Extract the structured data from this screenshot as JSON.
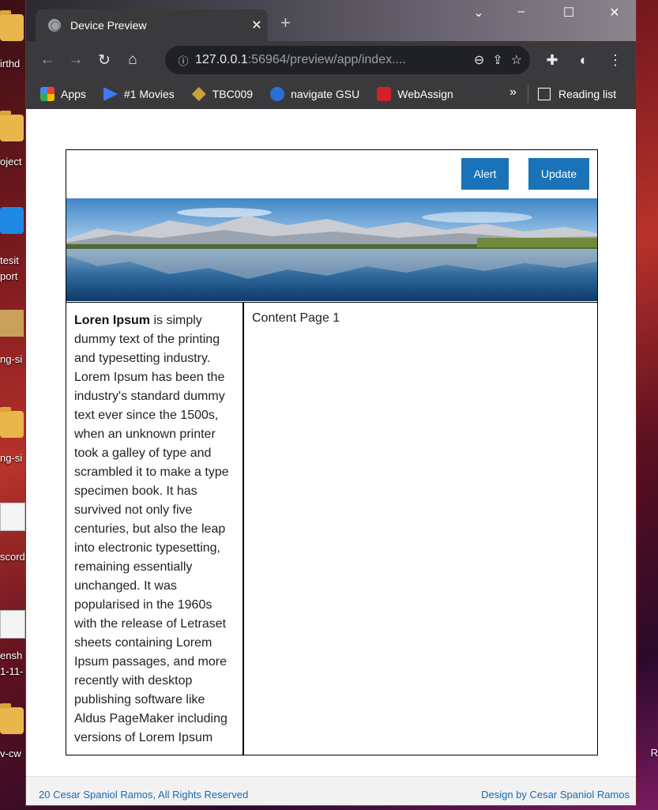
{
  "desktop": {
    "icons": [
      {
        "label": "irthd",
        "kind": "folder"
      },
      {
        "label": "oject",
        "kind": "folder"
      },
      {
        "label": "tesit",
        "label2": "port",
        "kind": "app"
      },
      {
        "label": "ng-si",
        "kind": "package"
      },
      {
        "label": "ng-si",
        "kind": "folder"
      },
      {
        "label": "scord",
        "kind": "doc"
      },
      {
        "label": "ensh",
        "label2": "1-11-",
        "kind": "image"
      },
      {
        "label": "v-cw",
        "kind": "folder"
      }
    ],
    "right_fragment": "R"
  },
  "browser": {
    "tab_title": "Device Preview",
    "url_host": "127.0.0.1",
    "url_rest": ":56964/preview/app/index....",
    "bookmarks": [
      {
        "label": "Apps",
        "icon": "apps-grid-icon",
        "color": "#4285f4"
      },
      {
        "label": "#1 Movies",
        "icon": "play-arrow-icon",
        "color": "#3d7bff"
      },
      {
        "label": "TBC009",
        "icon": "diamond-icon",
        "color": "#c9a23a"
      },
      {
        "label": "navigate GSU",
        "icon": "university-icon",
        "color": "#2a6fd6"
      },
      {
        "label": "WebAssign",
        "icon": "webassign-icon",
        "color": "#d0202a"
      }
    ],
    "more_bookmarks": "»",
    "reading_list": "Reading list"
  },
  "page": {
    "buttons": {
      "alert": "Alert",
      "update": "Update"
    },
    "left_bold": "Loren Ipsum",
    "left_text": " is simply dummy text of the printing and typesetting industry. Lorem Ipsum has been the industry's standard dummy text ever since the 1500s, when an unknown printer took a galley of type and scrambled it to make a type specimen book. It has survived not only five centuries, but also the leap into electronic typesetting, remaining essentially unchanged. It was popularised in the 1960s with the release of Letraset sheets containing Lorem Ipsum passages, and more recently with desktop publishing software like Aldus PageMaker including versions of Lorem Ipsum",
    "right_text": "Content Page 1",
    "footer_left": "20 Cesar Spaniol Ramos, All Rights Reserved",
    "footer_right": "Design by Cesar Spaniol Ramos"
  },
  "colors": {
    "accent": "#1a73b8",
    "footer_link": "#1a6ab0"
  }
}
